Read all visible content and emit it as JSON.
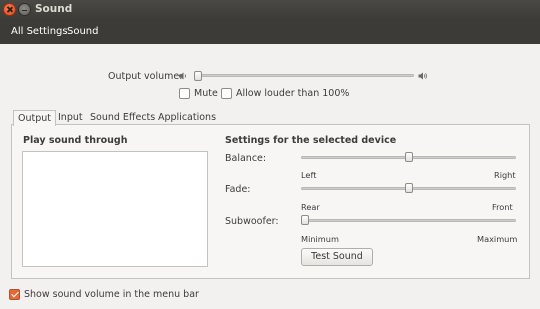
{
  "window": {
    "title": "Sound"
  },
  "nav": {
    "breadcrumbs": [
      "All Settings",
      "Sound"
    ]
  },
  "output_volume": {
    "label": "Output volume:",
    "level": 0.0,
    "mute_label": "Mute",
    "mute_checked": false,
    "louder_label": "Allow louder than 100%",
    "louder_checked": false
  },
  "tabs": [
    {
      "label": "Output",
      "active": true
    },
    {
      "label": "Input",
      "active": false
    },
    {
      "label": "Sound Effects",
      "active": false
    },
    {
      "label": "Applications",
      "active": false
    }
  ],
  "output": {
    "play_through_label": "Play sound through",
    "settings_title": "Settings for the selected device",
    "balance": {
      "label": "Balance:",
      "min_label": "Left",
      "max_label": "Right",
      "value": 0.5
    },
    "fade": {
      "label": "Fade:",
      "min_label": "Rear",
      "max_label": "Front",
      "value": 0.5
    },
    "subwoofer": {
      "label": "Subwoofer:",
      "min_label": "Minimum",
      "max_label": "Maximum",
      "value": 0.0
    },
    "test_button": "Test Sound"
  },
  "footer": {
    "show_volume_label": "Show sound volume in the menu bar",
    "show_volume_checked": true
  },
  "colors": {
    "accent": "#e26a3a",
    "titlebar": "#3c3b37",
    "background": "#f2f1f0"
  },
  "icons": [
    "close-icon",
    "minimize-icon",
    "speaker-low-icon",
    "speaker-high-icon",
    "checkmark-icon"
  ]
}
